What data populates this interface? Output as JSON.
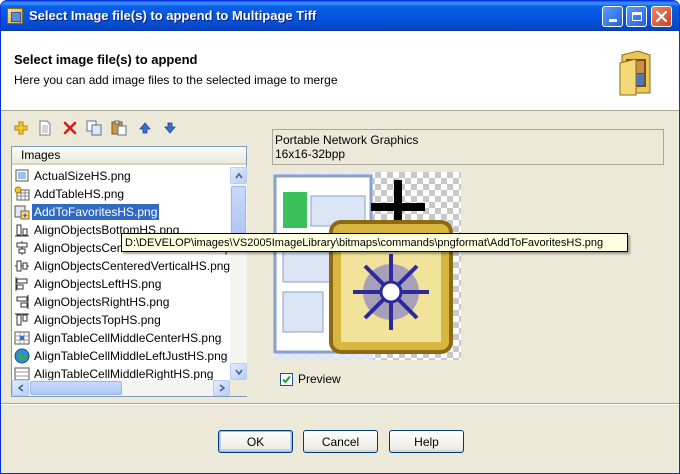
{
  "window": {
    "title": "Select Image file(s) to append to Multipage Tiff",
    "controls": {
      "minimize_icon": "minimize-icon",
      "maximize_icon": "maximize-icon",
      "close_icon": "close-icon"
    }
  },
  "header": {
    "title": "Select image file(s) to append",
    "subtitle": "Here you can add image files to the selected image to merge",
    "icon": "folder-images-icon"
  },
  "toolbar": {
    "buttons": [
      {
        "name": "add-button",
        "icon": "plus-icon"
      },
      {
        "name": "new-button",
        "icon": "new-document-icon"
      },
      {
        "name": "delete-button",
        "icon": "delete-x-icon"
      },
      {
        "name": "copy-button",
        "icon": "copy-icon"
      },
      {
        "name": "paste-button",
        "icon": "paste-icon"
      },
      {
        "name": "move-up-button",
        "icon": "arrow-up-icon"
      },
      {
        "name": "move-down-button",
        "icon": "arrow-down-icon"
      }
    ]
  },
  "list": {
    "column_header": "Images",
    "selected_index": 2,
    "items": [
      "ActualSizeHS.png",
      "AddTableHS.png",
      "AddToFavoritesHS.png",
      "AlignObjectsBottomHS.png",
      "AlignObjectsCenteredHorizontalHS.png",
      "AlignObjectsCenteredVerticalHS.png",
      "AlignObjectsLeftHS.png",
      "AlignObjectsRightHS.png",
      "AlignObjectsTopHS.png",
      "AlignTableCellMiddleCenterHS.png",
      "AlignTableCellMiddleLeftJustHS.png",
      "AlignTableCellMiddleRightHS.png"
    ]
  },
  "tooltip": "D:\\DEVELOP\\images\\VS2005ImageLibrary\\bitmaps\\commands\\pngformat\\AddToFavoritesHS.png",
  "info": {
    "format": "Portable Network Graphics",
    "dimensions": "16x16-32bpp"
  },
  "preview": {
    "label": "Preview",
    "checked": true
  },
  "buttons": {
    "ok": "OK",
    "cancel": "Cancel",
    "help": "Help"
  },
  "colors": {
    "titlebar": "#0553dd",
    "selection": "#316ac5",
    "dialog_bg": "#ece9d8",
    "tooltip_bg": "#ffffe1"
  }
}
